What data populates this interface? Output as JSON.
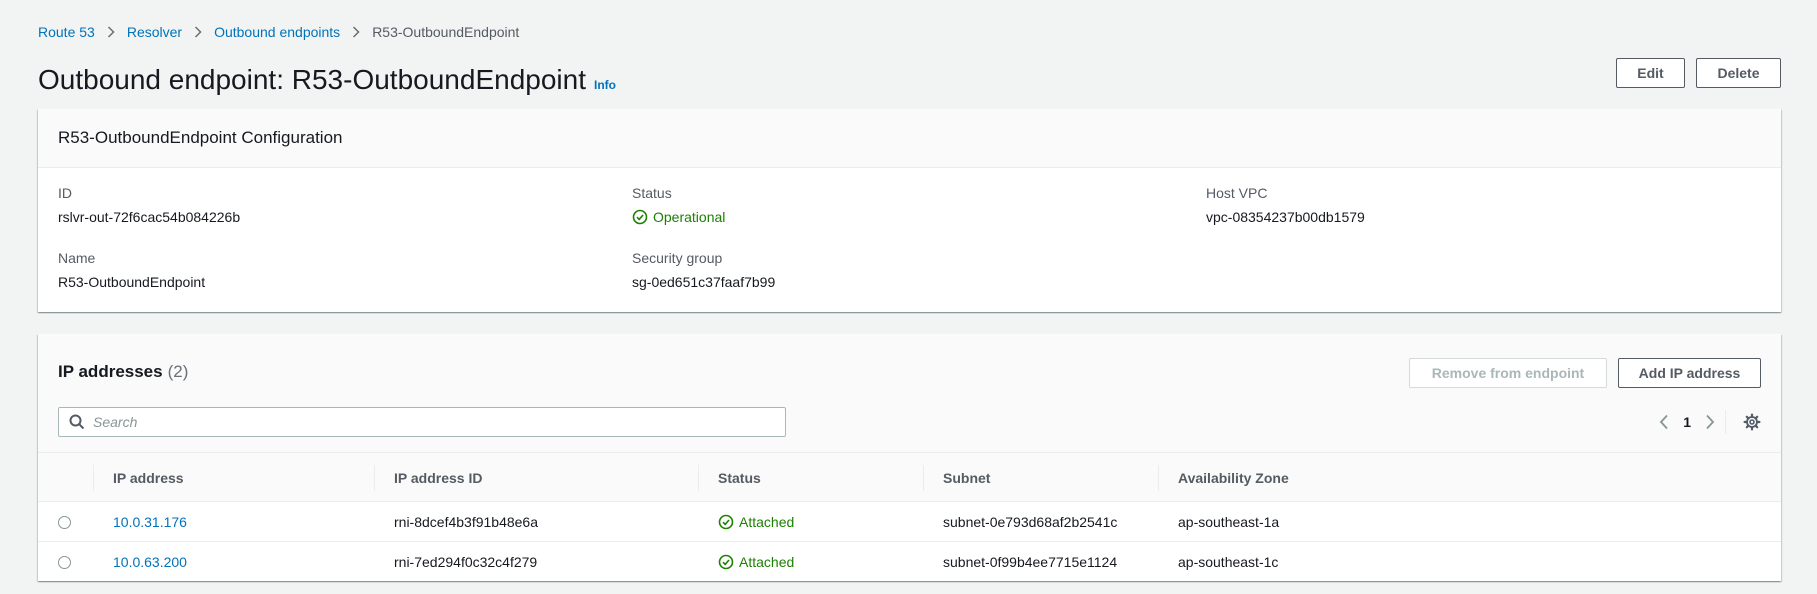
{
  "breadcrumb": {
    "items": [
      "Route 53",
      "Resolver",
      "Outbound endpoints"
    ],
    "current": "R53-OutboundEndpoint"
  },
  "header": {
    "title": "Outbound endpoint: R53-OutboundEndpoint",
    "info": "Info",
    "edit_label": "Edit",
    "delete_label": "Delete"
  },
  "config": {
    "title": "R53-OutboundEndpoint Configuration",
    "id_label": "ID",
    "id_value": "rslvr-out-72f6cac54b084226b",
    "status_label": "Status",
    "status_value": "Operational",
    "host_vpc_label": "Host VPC",
    "host_vpc_value": "vpc-08354237b00db1579",
    "name_label": "Name",
    "name_value": "R53-OutboundEndpoint",
    "sg_label": "Security group",
    "sg_value": "sg-0ed651c37faaf7b99"
  },
  "ip_section": {
    "title": "IP addresses",
    "count": "(2)",
    "remove_label": "Remove from endpoint",
    "add_label": "Add IP address",
    "search_placeholder": "Search",
    "page": "1",
    "columns": [
      "IP address",
      "IP address ID",
      "Status",
      "Subnet",
      "Availability Zone"
    ],
    "rows": [
      {
        "ip": "10.0.31.176",
        "ip_id": "rni-8dcef4b3f91b48e6a",
        "status": "Attached",
        "subnet": "subnet-0e793d68af2b2541c",
        "az": "ap-southeast-1a"
      },
      {
        "ip": "10.0.63.200",
        "ip_id": "rni-7ed294f0c32c4f279",
        "status": "Attached",
        "subnet": "subnet-0f99b4ee7715e1124",
        "az": "ap-southeast-1c"
      }
    ]
  },
  "colors": {
    "link": "#0073bb",
    "success": "#1d8102",
    "background": "#f2f3f3"
  },
  "icons": [
    "chevron-right-icon",
    "success-check-icon",
    "search-icon",
    "chevron-left-icon",
    "gear-icon"
  ]
}
